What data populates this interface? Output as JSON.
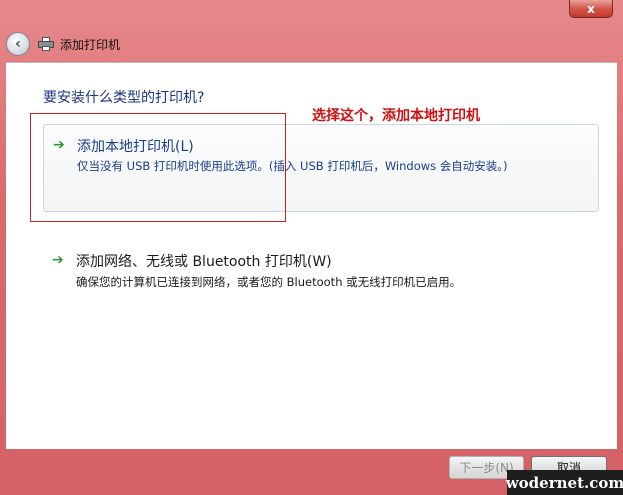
{
  "window": {
    "title": "添加打印机",
    "close_glyph": "x",
    "back_glyph": "‹"
  },
  "content": {
    "heading": "要安装什么类型的打印机?",
    "options": [
      {
        "title": "添加本地打印机(L)",
        "description": "仅当没有 USB 打印机时使用此选项。(插入 USB 打印机后，Windows 会自动安装。)",
        "arrow": "➔"
      },
      {
        "title": "添加网络、无线或 Bluetooth 打印机(W)",
        "description": "确保您的计算机已连接到网络，或者您的 Bluetooth 或无线打印机已启用。",
        "arrow": "➔"
      }
    ],
    "annotation": "选择这个，添加本地打印机"
  },
  "buttons": {
    "next": "下一步(N)",
    "cancel": "取消"
  },
  "watermark": "wodernet.com",
  "colors": {
    "frame": "#d96a6e",
    "link_blue": "#1a3d8f",
    "arrow_green": "#2e9a2e",
    "annotation_red": "#d01010"
  }
}
